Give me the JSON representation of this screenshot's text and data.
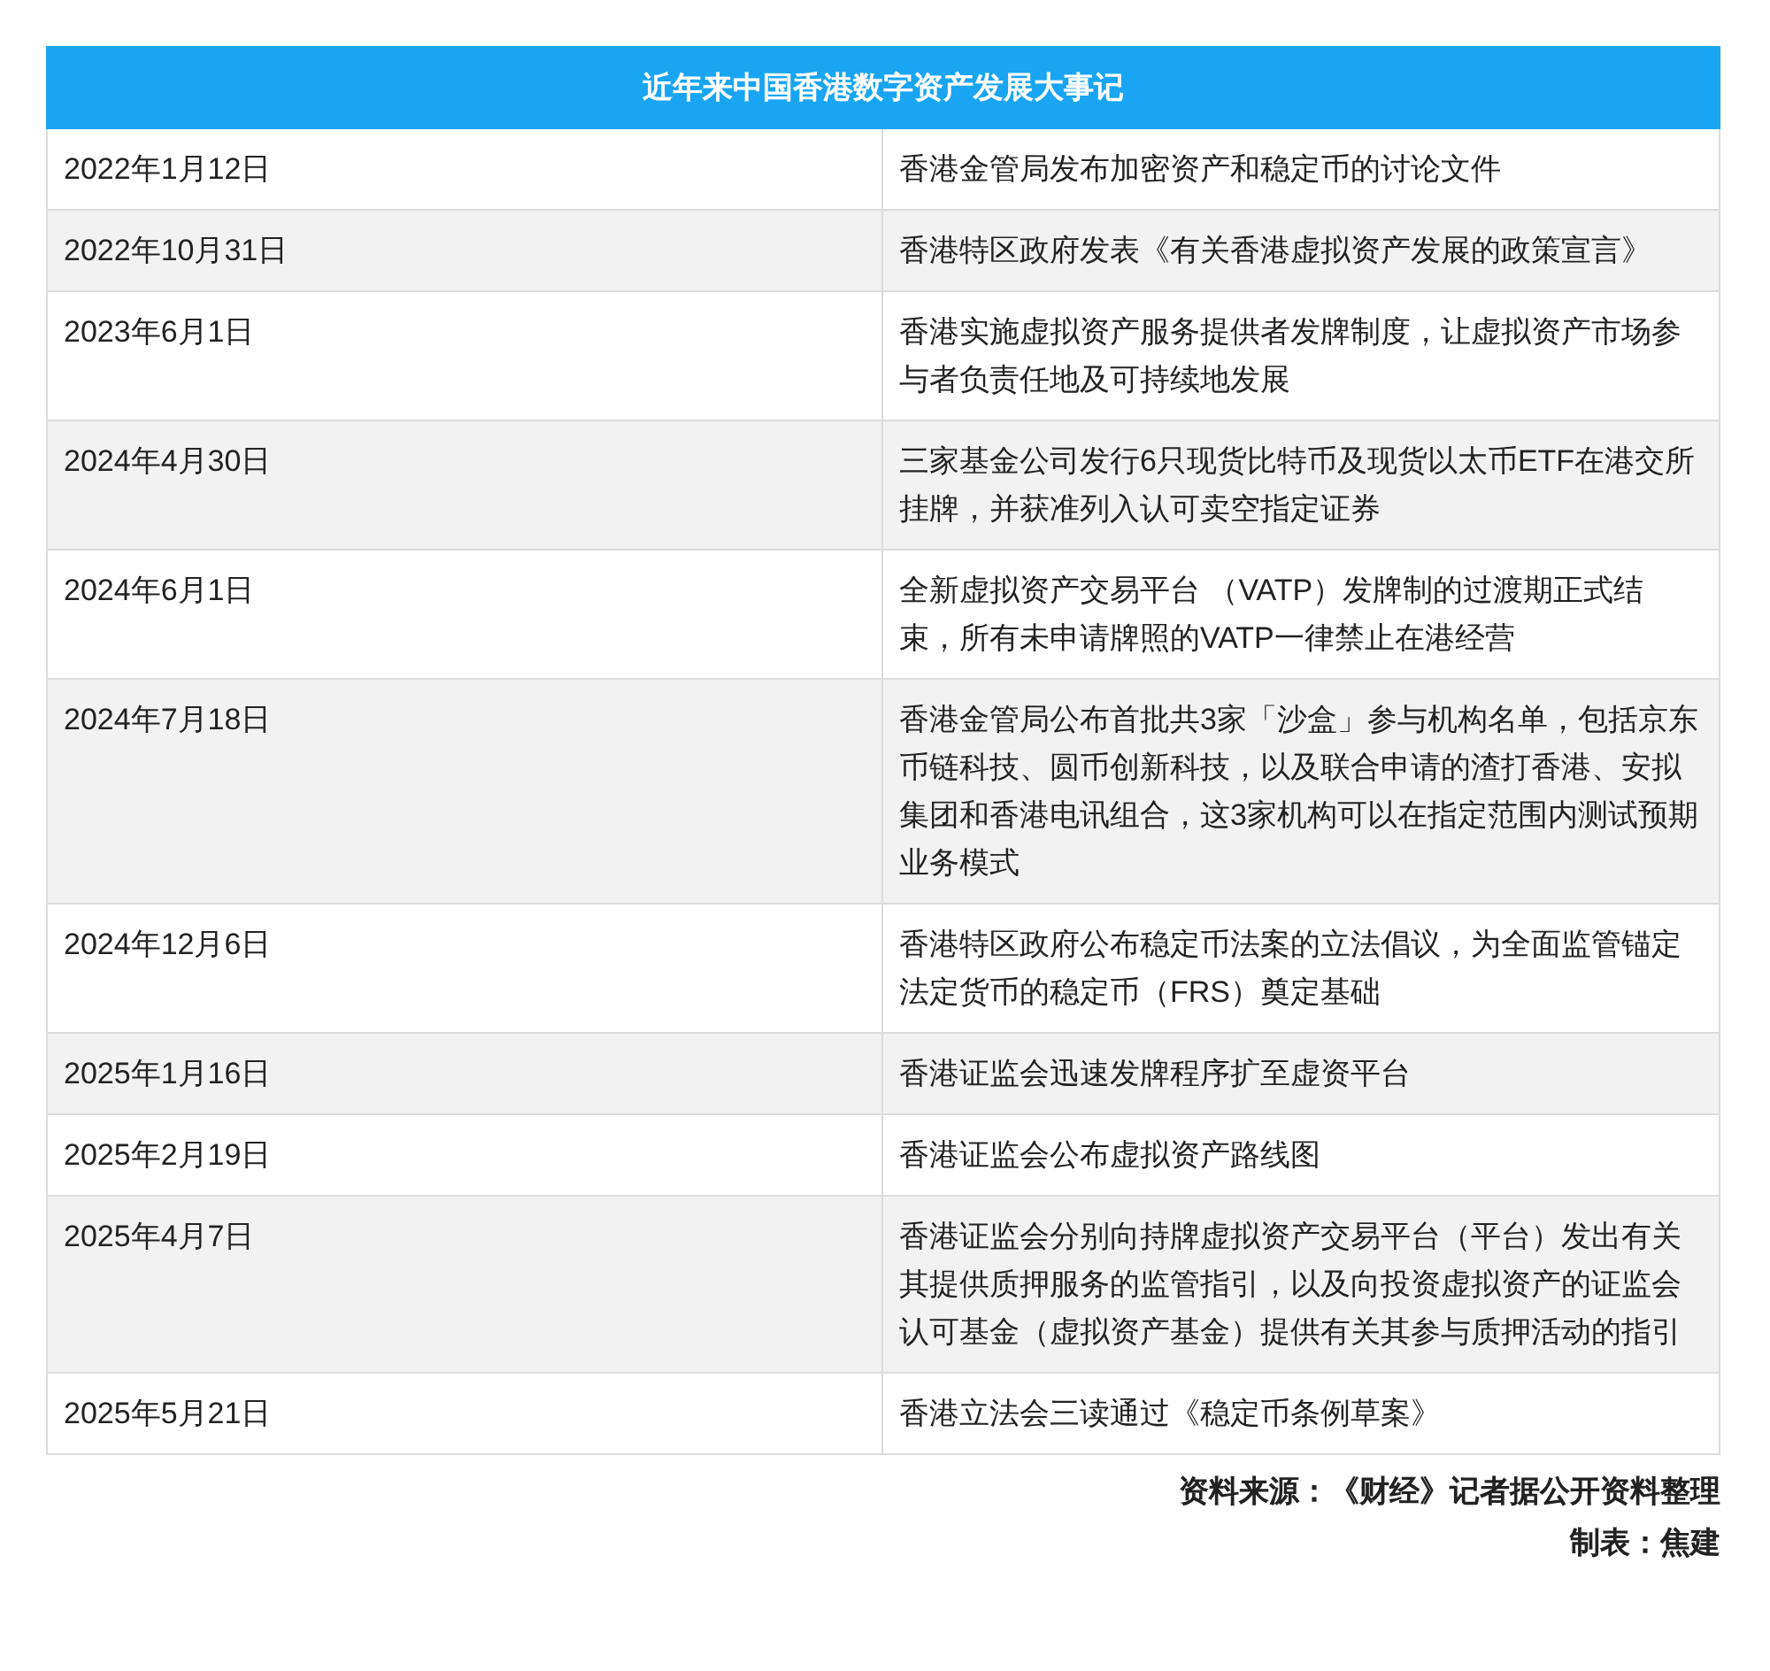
{
  "table": {
    "title": "近年来中国香港数字资产发展大事记",
    "rows": [
      {
        "date": "2022年1月12日",
        "event": "香港金管局发布加密资产和稳定币的讨论文件"
      },
      {
        "date": "2022年10月31日",
        "event": "香港特区政府发表《有关香港虚拟资产发展的政策宣言》"
      },
      {
        "date": "2023年6月1日",
        "event": "香港实施虚拟资产服务提供者发牌制度，让虚拟资产市场参与者负责任地及可持续地发展"
      },
      {
        "date": "2024年4月30日",
        "event": "三家基金公司发行6只现货比特币及现货以太币ETF在港交所挂牌，并获准列入认可卖空指定证券"
      },
      {
        "date": "2024年6月1日",
        "event": "全新虚拟资产交易平台 （VATP）发牌制的过渡期正式结束，所有未申请牌照的VATP一律禁止在港经营"
      },
      {
        "date": "2024年7月18日",
        "event": "香港金管局公布首批共3家「沙盒」参与机构名单，包括京东币链科技、圆币创新科技，以及联合申请的渣打香港、安拟集团和香港电讯组合，这3家机构可以在指定范围内测试预期业务模式"
      },
      {
        "date": "2024年12月6日",
        "event": "香港特区政府公布稳定币法案的立法倡议，为全面监管锚定法定货币的稳定币（FRS）奠定基础"
      },
      {
        "date": "2025年1月16日",
        "event": "香港证监会迅速发牌程序扩至虚资平台"
      },
      {
        "date": "2025年2月19日",
        "event": "香港证监会公布虚拟资产路线图"
      },
      {
        "date": "2025年4月7日",
        "event": "香港证监会分别向持牌虚拟资产交易平台（平台）发出有关其提供质押服务的监管指引，以及向投资虚拟资产的证监会认可基金（虚拟资产基金）提供有关其参与质押活动的指引"
      },
      {
        "date": "2025年5月21日",
        "event": "香港立法会三读通过《稳定币条例草案》"
      }
    ]
  },
  "source": "资料来源：《财经》记者据公开资料整理",
  "credit": "制表：焦建"
}
